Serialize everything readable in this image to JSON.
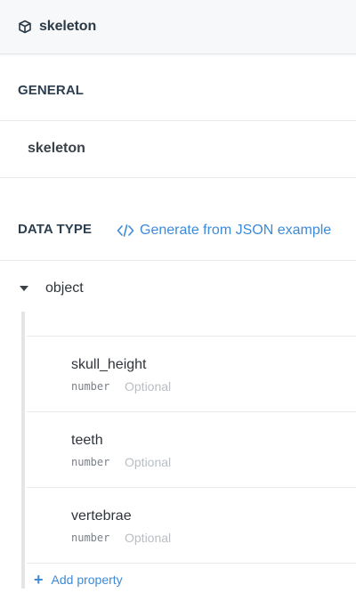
{
  "header": {
    "title": "skeleton",
    "icon": "cube-icon"
  },
  "general": {
    "label": "GENERAL",
    "name_value": "skeleton"
  },
  "data_type": {
    "label": "DATA TYPE",
    "generate_link": "Generate from JSON example",
    "root_type": "object"
  },
  "properties": [
    {
      "name": "skull_height",
      "type": "number",
      "status": "Optional"
    },
    {
      "name": "teeth",
      "type": "number",
      "status": "Optional"
    },
    {
      "name": "vertebrae",
      "type": "number",
      "status": "Optional"
    }
  ],
  "add_property_label": "Add property",
  "colors": {
    "accent": "#3d8ad9",
    "header_bg": "#f7f8f9"
  }
}
